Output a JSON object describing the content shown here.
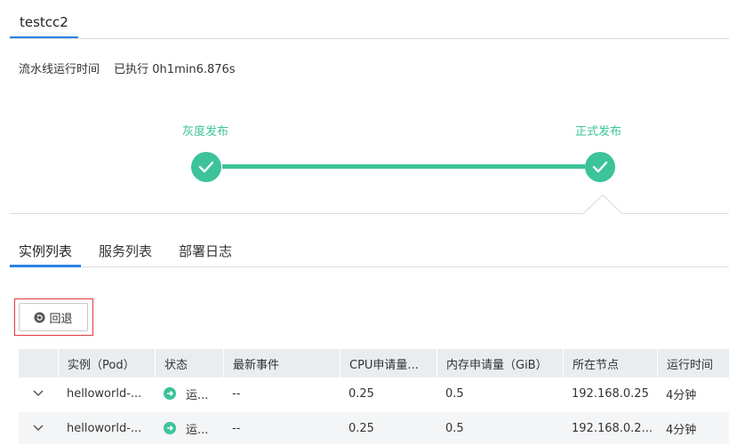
{
  "header": {
    "title": "testcc2"
  },
  "runtime": {
    "label": "流水线运行时间",
    "value": "已执行 0h1min6.876s"
  },
  "pipeline": {
    "stages": [
      {
        "label": "灰度发布",
        "status": "success"
      },
      {
        "label": "正式发布",
        "status": "success"
      }
    ],
    "color": "#3cc39a"
  },
  "tabs": [
    {
      "label": "实例列表",
      "active": true
    },
    {
      "label": "服务列表",
      "active": false
    },
    {
      "label": "部署日志",
      "active": false
    }
  ],
  "toolbar": {
    "rollback_label": "回退",
    "rollback_icon": "rollback-icon"
  },
  "table": {
    "columns": [
      "实例（Pod）",
      "状态",
      "最新事件",
      "CPU申请量...",
      "内存申请量（GiB）",
      "所在节点",
      "运行时间"
    ],
    "rows": [
      {
        "name": "helloworld-...",
        "status": "运...",
        "event": "--",
        "cpu": "0.25",
        "mem": "0.5",
        "node": "192.168.0.25",
        "uptime": "4分钟"
      },
      {
        "name": "helloworld-...",
        "status": "运...",
        "event": "--",
        "cpu": "0.25",
        "mem": "0.5",
        "node": "192.168.0.2...",
        "uptime": "4分钟"
      }
    ]
  },
  "colors": {
    "accent": "#2a82e4",
    "success": "#3cc39a",
    "highlight": "#e4393c"
  }
}
